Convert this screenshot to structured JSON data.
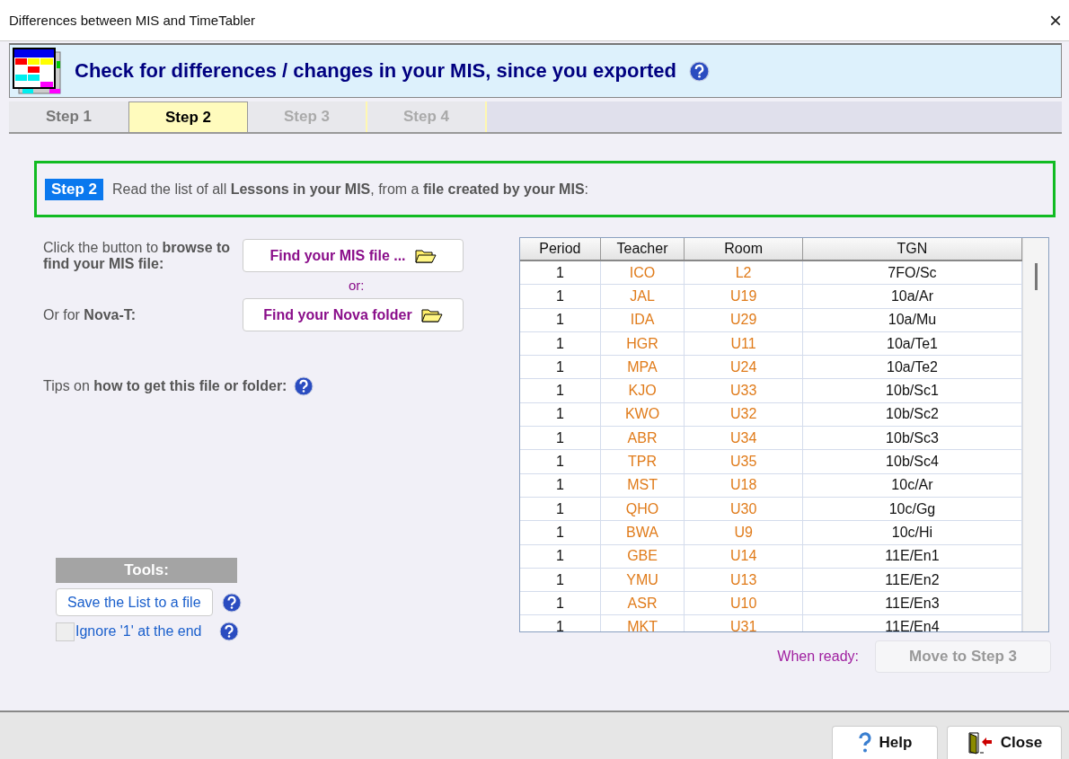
{
  "window": {
    "title": "Differences between MIS and TimeTabler",
    "close": "×"
  },
  "header": {
    "title": "Check for differences / changes in your MIS, since you exported"
  },
  "tabs": [
    {
      "label": "Step 1",
      "selected": false,
      "disabled": false
    },
    {
      "label": "Step 2",
      "selected": true,
      "disabled": false
    },
    {
      "label": "Step 3",
      "selected": false,
      "disabled": true
    },
    {
      "label": "Step 4",
      "selected": false,
      "disabled": true
    }
  ],
  "step_banner": {
    "badge": "Step 2",
    "text": "Read the list of all **Lessons in your MIS**, from a **file created by your MIS**:"
  },
  "browse": {
    "label": "Click the button to **browse to find your MIS file:**",
    "button": "Find your MIS file ...",
    "or": "or:",
    "nova_label": "Or for **Nova-T:**",
    "nova_button": "Find your Nova folder",
    "tips": "Tips on **how to get this file or folder:**"
  },
  "tools": {
    "title": "Tools:",
    "save_button": "Save the List to a file",
    "ignore_checkbox": {
      "label": "Ignore '1' at the end",
      "checked": false
    }
  },
  "table": {
    "columns": [
      "Period",
      "Teacher",
      "Room",
      "TGN"
    ],
    "rows": [
      [
        "1",
        "ICO",
        "L2",
        "7FO/Sc"
      ],
      [
        "1",
        "JAL",
        "U19",
        "10a/Ar"
      ],
      [
        "1",
        "IDA",
        "U29",
        "10a/Mu"
      ],
      [
        "1",
        "HGR",
        "U11",
        "10a/Te1"
      ],
      [
        "1",
        "MPA",
        "U24",
        "10a/Te2"
      ],
      [
        "1",
        "KJO",
        "U33",
        "10b/Sc1"
      ],
      [
        "1",
        "KWO",
        "U32",
        "10b/Sc2"
      ],
      [
        "1",
        "ABR",
        "U34",
        "10b/Sc3"
      ],
      [
        "1",
        "TPR",
        "U35",
        "10b/Sc4"
      ],
      [
        "1",
        "MST",
        "U18",
        "10c/Ar"
      ],
      [
        "1",
        "QHO",
        "U30",
        "10c/Gg"
      ],
      [
        "1",
        "BWA",
        "U9",
        "10c/Hi"
      ],
      [
        "1",
        "GBE",
        "U14",
        "11E/En1"
      ],
      [
        "1",
        "YMU",
        "U13",
        "11E/En2"
      ],
      [
        "1",
        "ASR",
        "U10",
        "11E/En3"
      ],
      [
        "1",
        "MKT",
        "U31",
        "11E/En4"
      ]
    ]
  },
  "next": {
    "label": "When ready:",
    "button": "Move to Step 3",
    "disabled": true
  },
  "footer": {
    "help": "Help",
    "close": "Close"
  }
}
